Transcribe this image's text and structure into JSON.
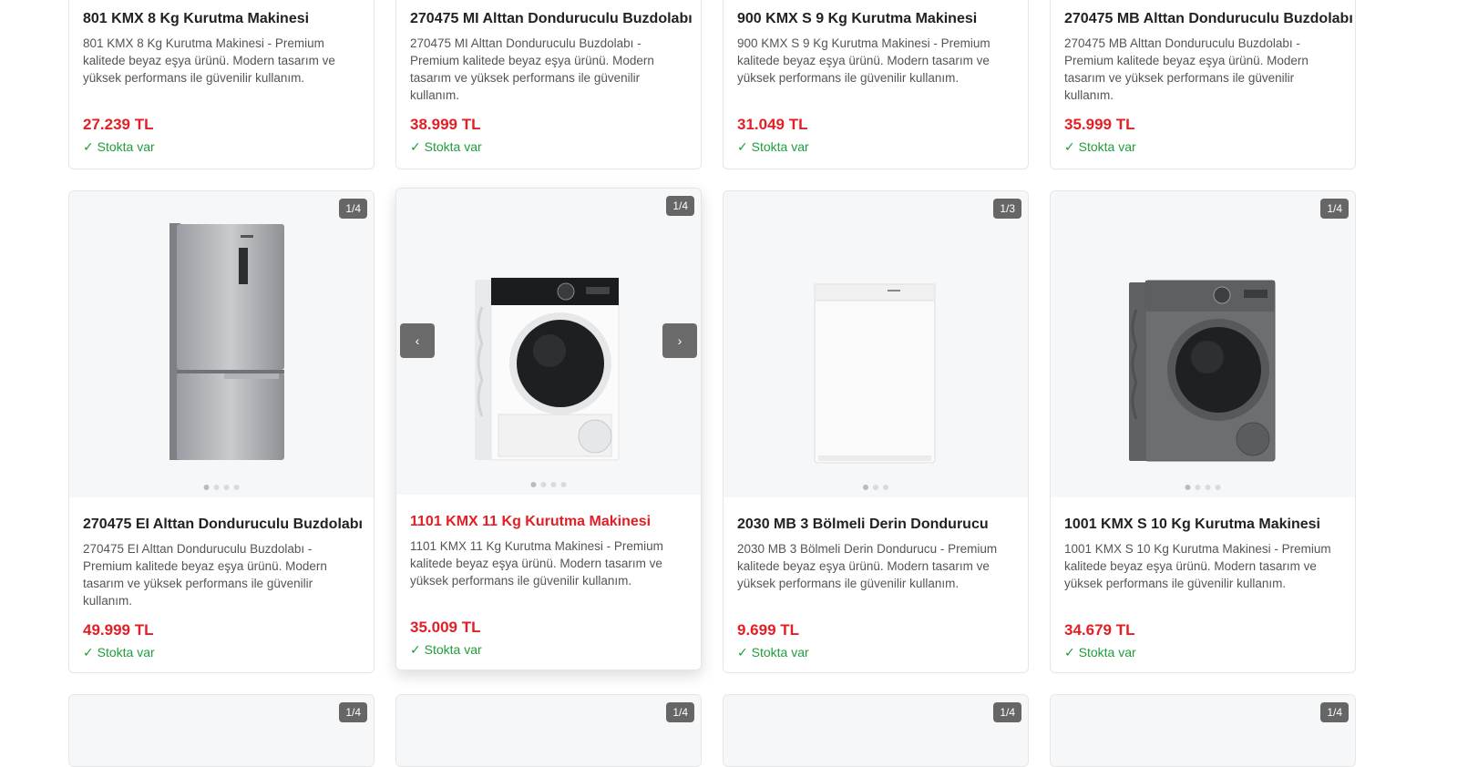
{
  "row1": [
    {
      "title": "801 KMX 8 Kg Kurutma Makinesi",
      "desc": "801 KMX 8 Kg Kurutma Makinesi - Premium kalitede beyaz eşya ürünü. Modern tasarım ve yüksek performans ile güvenilir kullanım.",
      "price": "27.239 TL",
      "stock": "✓ Stokta var"
    },
    {
      "title": "270475 MI Alttan Donduruculu Buzdolabı",
      "desc": "270475 MI Alttan Donduruculu Buzdolabı - Premium kalitede beyaz eşya ürünü. Modern tasarım ve yüksek performans ile güvenilir kullanım.",
      "price": "38.999 TL",
      "stock": "✓ Stokta var"
    },
    {
      "title": "900 KMX S 9 Kg Kurutma Makinesi",
      "desc": "900 KMX S 9 Kg Kurutma Makinesi - Premium kalitede beyaz eşya ürünü. Modern tasarım ve yüksek performans ile güvenilir kullanım.",
      "price": "31.049 TL",
      "stock": "✓ Stokta var"
    },
    {
      "title": "270475 MB Alttan Donduruculu Buzdolabı",
      "desc": "270475 MB Alttan Donduruculu Buzdolabı - Premium kalitede beyaz eşya ürünü. Modern tasarım ve yüksek performans ile güvenilir kullanım.",
      "price": "35.999 TL",
      "stock": "✓ Stokta var"
    }
  ],
  "row2": [
    {
      "badge": "1/4",
      "title": "270475 EI Alttan Donduruculu Buzdolabı",
      "desc": "270475 EI Alttan Donduruculu Buzdolabı - Premium kalitede beyaz eşya ürünü. Modern tasarım ve yüksek performans ile güvenilir kullanım.",
      "price": "49.999 TL",
      "stock": "✓ Stokta var",
      "image": "fridge-silver",
      "dots": 4
    },
    {
      "badge": "1/4",
      "title": "1101 KMX 11 Kg Kurutma Makinesi",
      "desc": "1101 KMX 11 Kg Kurutma Makinesi - Premium kalitede beyaz eşya ürünü. Modern tasarım ve yüksek performans ile güvenilir kullanım.",
      "price": "35.009 TL",
      "stock": "✓ Stokta var",
      "image": "dryer-white",
      "dots": 4,
      "prev_icon": "‹",
      "next_icon": "›"
    },
    {
      "badge": "1/3",
      "title": "2030 MB 3 Bölmeli Derin Dondurucu",
      "desc": "2030 MB 3 Bölmeli Derin Dondurucu - Premium kalitede beyaz eşya ürünü. Modern tasarım ve yüksek performans ile güvenilir kullanım.",
      "price": "9.699 TL",
      "stock": "✓ Stokta var",
      "image": "freezer-white",
      "dots": 3
    },
    {
      "badge": "1/4",
      "title": "1001 KMX S 10 Kg Kurutma Makinesi",
      "desc": "1001 KMX S 10 Kg Kurutma Makinesi - Premium kalitede beyaz eşya ürünü. Modern tasarım ve yüksek performans ile güvenilir kullanım.",
      "price": "34.679 TL",
      "stock": "✓ Stokta var",
      "image": "dryer-grey",
      "dots": 4
    }
  ],
  "row3": [
    {
      "badge": "1/4"
    },
    {
      "badge": "1/4"
    },
    {
      "badge": "1/4"
    },
    {
      "badge": "1/4"
    }
  ],
  "colors": {
    "price": "#e31e24",
    "stock": "#1f9d3a",
    "badge": "#666666",
    "image_bg": "#f6f7f9"
  }
}
